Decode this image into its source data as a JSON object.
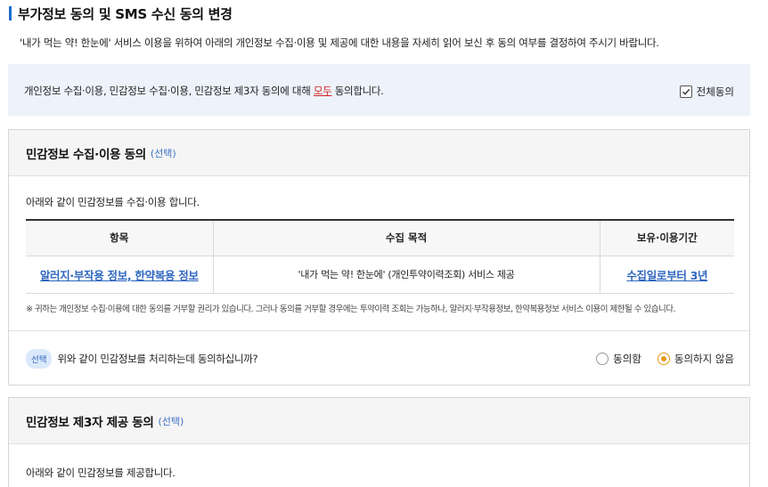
{
  "page": {
    "title": "부가정보 동의 및 SMS 수신 동의 변경",
    "intro": "'내가 먹는 약! 한눈에' 서비스 이용을 위하여 아래의 개인정보 수집·이용 및 제공에 대한 내용을 자세히 읽어 보신 후 동의 여부를 결정하여 주시기 바랍니다."
  },
  "all_agree": {
    "text_before": "개인정보 수집·이용, 민감정보 수집·이용, 민감정보 제3자 동의에 대해 ",
    "highlight": "모두",
    "text_after": " 동의합니다.",
    "checkbox_label": "전체동의",
    "checked": true
  },
  "section1": {
    "title": "민감정보 수집·이용 동의",
    "optional": "(선택)",
    "desc": "아래와 같이 민감정보를 수집·이용 합니다.",
    "table": {
      "headers": [
        "항목",
        "수집 목적",
        "보유·이용기간"
      ],
      "row": {
        "item": "알러지·부작용 정보, 한약복용 정보",
        "purpose": "'내가 먹는 약! 한눈에' (개인투약이력조회) 서비스 제공",
        "period": "수집일로부터 3년"
      }
    },
    "notice": "※ 귀하는 개인정보 수집·이용에 대한 동의를 거부할 권리가 있습니다. 그러나 동의를 거부할 경우에는 투약이력 조회는 가능하나, 알러지·부작용정보, 한약복용정보 서비스 이용이 제한될 수 있습니다.",
    "badge": "선택",
    "question": "위와 같이 민감정보를 처리하는데 동의하십니까?",
    "options": [
      "동의함",
      "동의하지 않음"
    ],
    "selected": "동의하지 않음"
  },
  "section2": {
    "title": "민감정보 제3자 제공 동의",
    "optional": "(선택)",
    "desc": "아래와 같이 민감정보를 제공합니다."
  },
  "colors": {
    "accent": "#1f6fd1",
    "link": "#2f67bf",
    "highlight": "#d12424",
    "radio_selected": "#e69a16",
    "all_agree_bg": "#eef3fb"
  }
}
